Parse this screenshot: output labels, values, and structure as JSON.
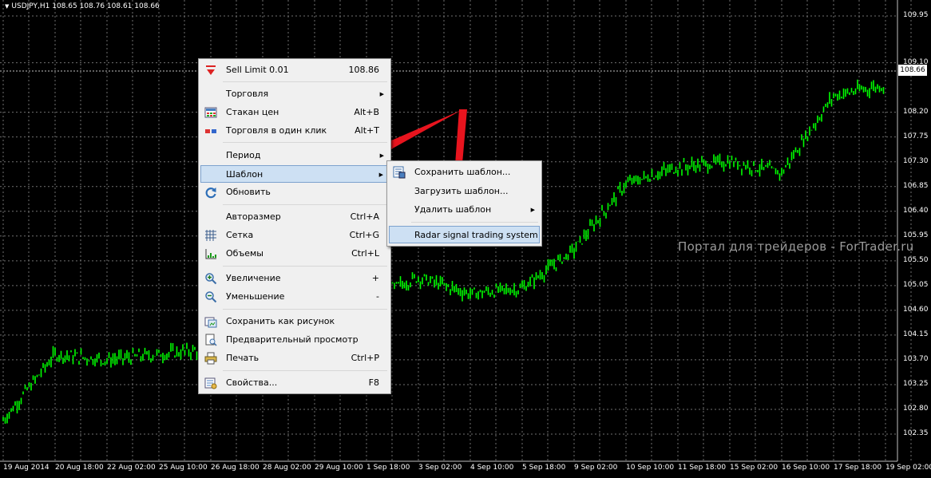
{
  "chart": {
    "title": "USDJPY,H1  108.65 108.76 108.61 108.66",
    "watermark": "Портал для трейдеров - ForTrader.ru",
    "current_price": "108.66",
    "y_ticks": [
      "109.95",
      "109.10",
      "108.20",
      "107.75",
      "107.30",
      "106.85",
      "106.40",
      "105.95",
      "105.50",
      "105.05",
      "104.60",
      "104.15",
      "103.70",
      "103.25",
      "102.80",
      "102.35"
    ],
    "x_ticks": [
      "19 Aug 2014",
      "20 Aug 18:00",
      "22 Aug 02:00",
      "25 Aug 10:00",
      "26 Aug 18:00",
      "28 Aug 02:00",
      "29 Aug 10:00",
      "1 Sep 18:00",
      "3 Sep 02:00",
      "4 Sep 10:00",
      "5 Sep 18:00",
      "9 Sep 02:00",
      "10 Sep 10:00",
      "11 Sep 18:00",
      "15 Sep 02:00",
      "16 Sep 10:00",
      "17 Sep 18:00",
      "19 Sep 02:00"
    ],
    "colors": {
      "candles": "#00ff00",
      "grid": "#707070",
      "background": "#000000"
    }
  },
  "chart_data": {
    "type": "line",
    "title": "USDJPY,H1",
    "xlabel": "",
    "ylabel": "",
    "ylim": [
      102.35,
      109.95
    ],
    "x": [
      "19 Aug 2014",
      "20 Aug 18:00",
      "22 Aug 02:00",
      "25 Aug 10:00",
      "26 Aug 18:00",
      "28 Aug 02:00",
      "29 Aug 10:00",
      "1 Sep 18:00",
      "3 Sep 02:00",
      "4 Sep 10:00",
      "5 Sep 18:00",
      "9 Sep 02:00",
      "10 Sep 10:00",
      "11 Sep 18:00",
      "15 Sep 02:00",
      "16 Sep 10:00",
      "17 Sep 18:00",
      "19 Sep 02:00"
    ],
    "series": [
      {
        "values": [
          102.6,
          103.8,
          103.7,
          103.8,
          103.9,
          104.0,
          104.6,
          104.8,
          105.2,
          104.9,
          105.0,
          105.7,
          106.9,
          107.2,
          107.3,
          107.1,
          108.5,
          108.7
        ]
      }
    ]
  },
  "context_menu": {
    "items": [
      {
        "label": "Sell Limit 0.01",
        "shortcut": "108.86",
        "icon": "sell-limit-icon"
      },
      {
        "label": "Торговля",
        "shortcut": "",
        "arrow": "▶"
      },
      {
        "label": "Стакан цен",
        "shortcut": "Alt+B",
        "icon": "depth-of-market-icon"
      },
      {
        "label": "Торговля в один клик",
        "shortcut": "Alt+T",
        "icon": "one-click-trading-icon"
      },
      {
        "label": "Период",
        "shortcut": "",
        "arrow": "▶"
      },
      {
        "label": "Шаблон",
        "shortcut": "",
        "arrow": "▶"
      },
      {
        "label": "Обновить",
        "shortcut": "",
        "icon": "refresh-icon"
      },
      {
        "label": "Авторазмер",
        "shortcut": "Ctrl+A"
      },
      {
        "label": "Сетка",
        "shortcut": "Ctrl+G",
        "icon": "grid-icon"
      },
      {
        "label": "Объемы",
        "shortcut": "Ctrl+L",
        "icon": "volumes-icon"
      },
      {
        "label": "Увеличение",
        "shortcut": "+",
        "icon": "zoom-in-icon"
      },
      {
        "label": "Уменьшение",
        "shortcut": "-",
        "icon": "zoom-out-icon"
      },
      {
        "label": "Сохранить как рисунок",
        "shortcut": "",
        "icon": "save-picture-icon"
      },
      {
        "label": "Предварительный просмотр",
        "shortcut": "",
        "icon": "print-preview-icon"
      },
      {
        "label": "Печать",
        "shortcut": "Ctrl+P",
        "icon": "print-icon"
      },
      {
        "label": "Свойства...",
        "shortcut": "F8",
        "icon": "properties-icon"
      }
    ]
  },
  "template_submenu": {
    "items": [
      {
        "label": "Сохранить шаблон...",
        "icon": "save-template-icon"
      },
      {
        "label": "Загрузить шаблон..."
      },
      {
        "label": "Удалить шаблон",
        "arrow": "▶"
      },
      {
        "label": "Radar signal trading system"
      }
    ]
  },
  "annotation": {
    "arrow_color": "#e8141e"
  }
}
